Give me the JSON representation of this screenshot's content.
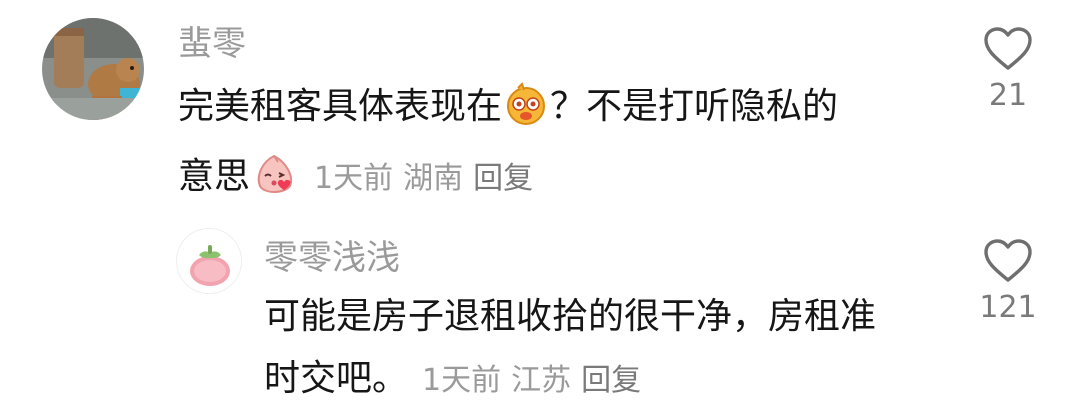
{
  "comments": [
    {
      "username": "蜚零",
      "line1_before": "完美租客具体表现在",
      "emoji1": "squinting-face-emoji",
      "line1_after": "？不是打听隐私的",
      "line2": "意思",
      "emoji2": "blowing-kiss-peach-emoji",
      "time": "1天前",
      "location": "湖南",
      "reply_label": "回复",
      "likes": "21"
    },
    {
      "username": "零零浅浅",
      "line1": "可能是房子退租收拾的很干净，房租准",
      "line2": "时交吧。",
      "time": "1天前",
      "location": "江苏",
      "reply_label": "回复",
      "likes": "121"
    }
  ]
}
